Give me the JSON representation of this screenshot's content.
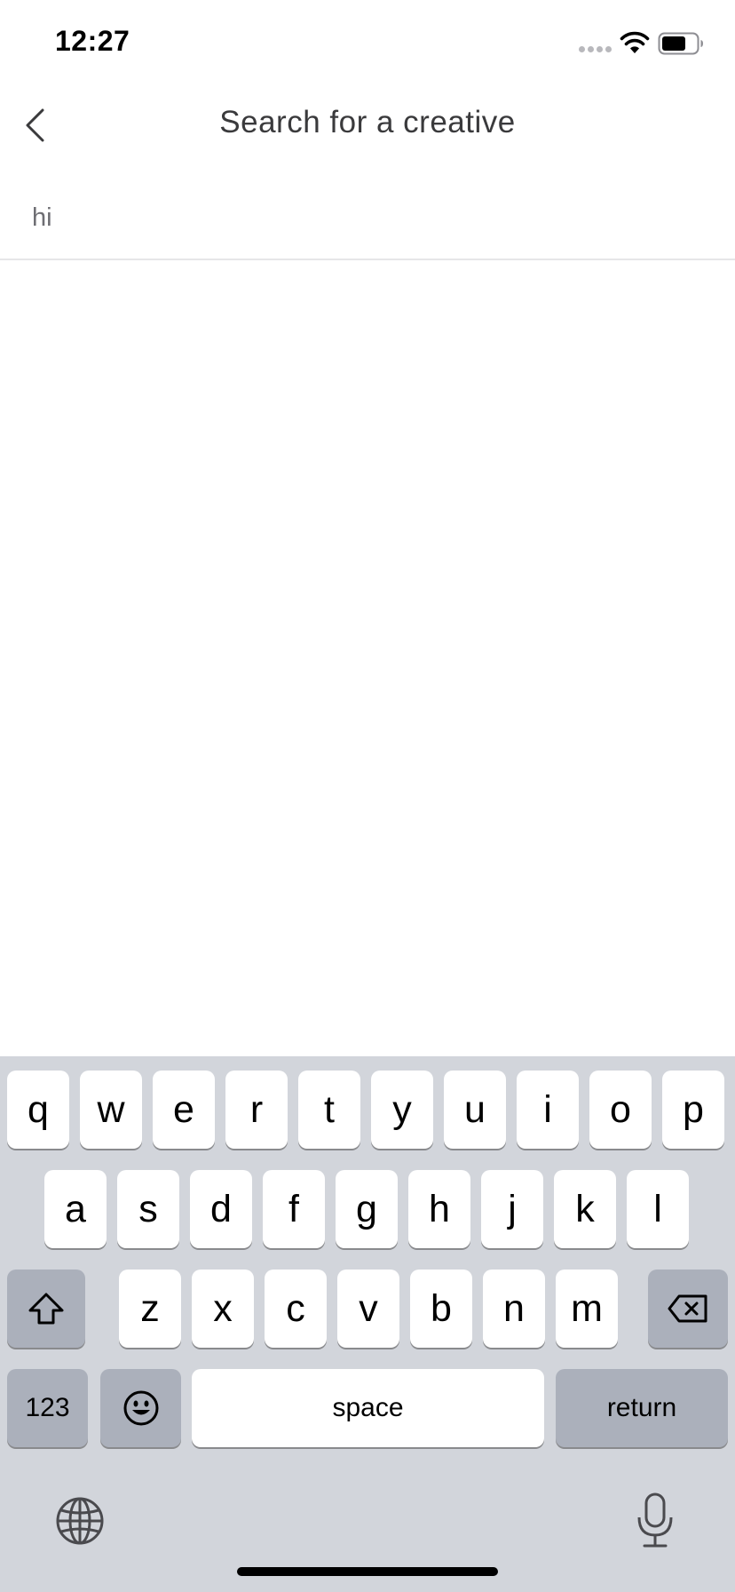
{
  "status_bar": {
    "time": "12:27",
    "signal_icon": "signal-dots-icon",
    "wifi_icon": "wifi-icon",
    "battery_icon": "battery-icon"
  },
  "header": {
    "back_icon": "chevron-left-icon",
    "title": "Search for a creative"
  },
  "search": {
    "value": "hi",
    "divider_color": "#e6e6e8"
  },
  "keyboard": {
    "row1": [
      "q",
      "w",
      "e",
      "r",
      "t",
      "y",
      "u",
      "i",
      "o",
      "p"
    ],
    "row2": [
      "a",
      "s",
      "d",
      "f",
      "g",
      "h",
      "j",
      "k",
      "l"
    ],
    "row3": [
      "z",
      "x",
      "c",
      "v",
      "b",
      "n",
      "m"
    ],
    "shift_icon": "shift-icon",
    "delete_icon": "delete-icon",
    "numbers_label": "123",
    "emoji_icon": "emoji-icon",
    "space_label": "space",
    "return_label": "return",
    "globe_icon": "globe-icon",
    "mic_icon": "microphone-icon",
    "colors": {
      "background": "#d2d5db",
      "key": "#ffffff",
      "function_key": "#abb0bb"
    }
  }
}
